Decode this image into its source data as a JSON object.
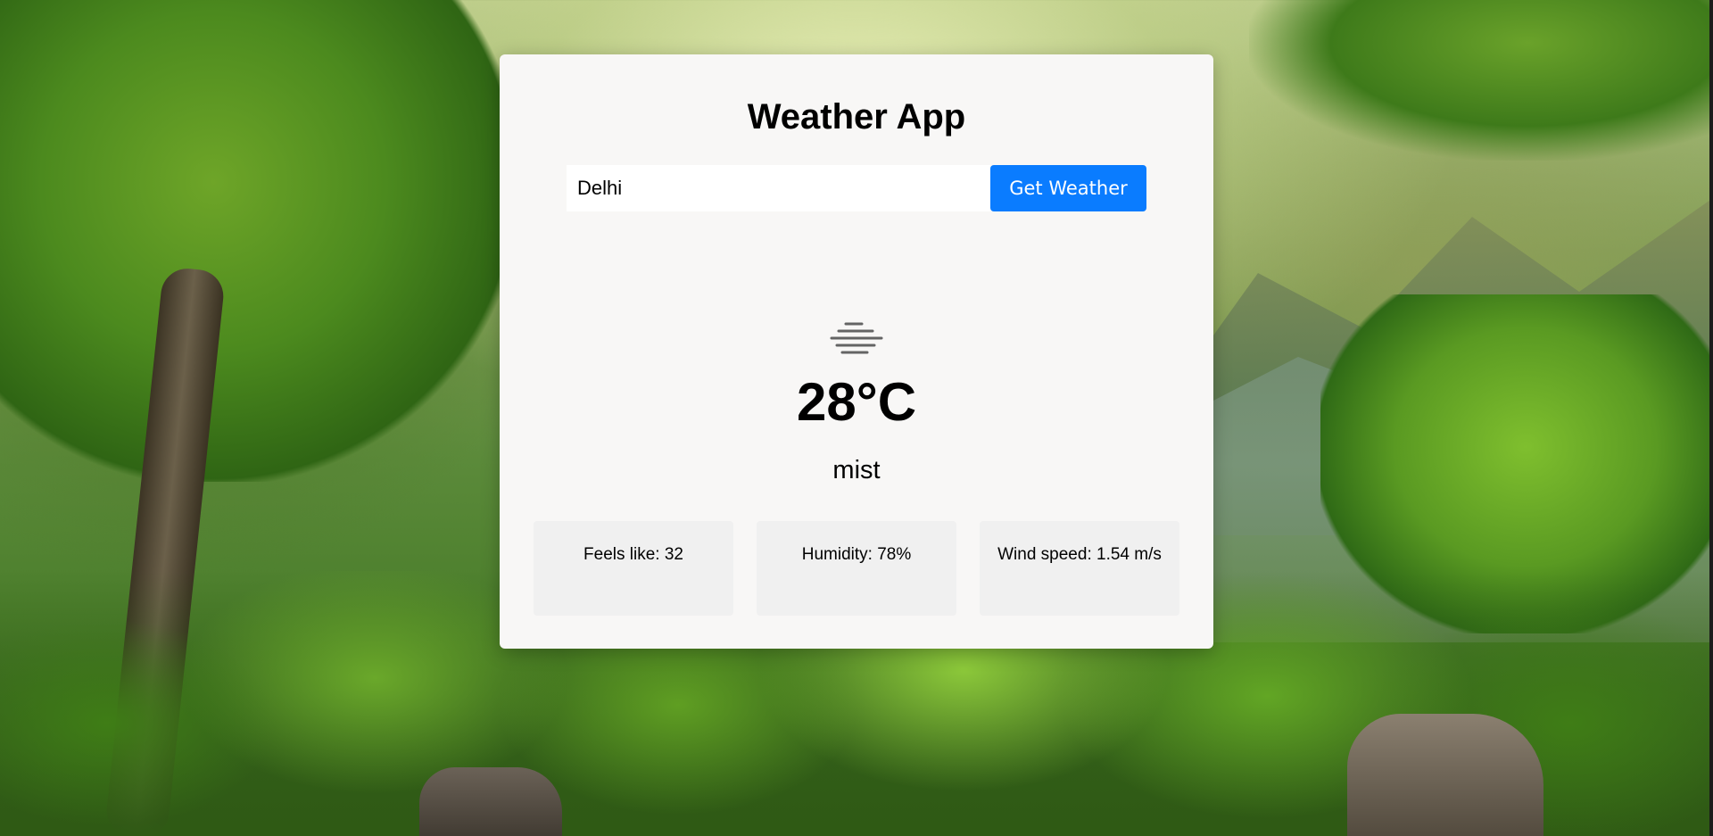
{
  "app": {
    "title": "Weather App"
  },
  "search": {
    "value": "Delhi",
    "button_label": "Get Weather"
  },
  "weather": {
    "icon": "mist-icon",
    "temperature": "28°C",
    "description": "mist"
  },
  "details": [
    {
      "text": "Feels like: 32"
    },
    {
      "text": "Humidity: 78%"
    },
    {
      "text": "Wind speed: 1.54 m/s"
    }
  ],
  "colors": {
    "accent": "#0a7cff",
    "card_background": "#f8f7f6",
    "detail_background": "#f0f0f0"
  }
}
